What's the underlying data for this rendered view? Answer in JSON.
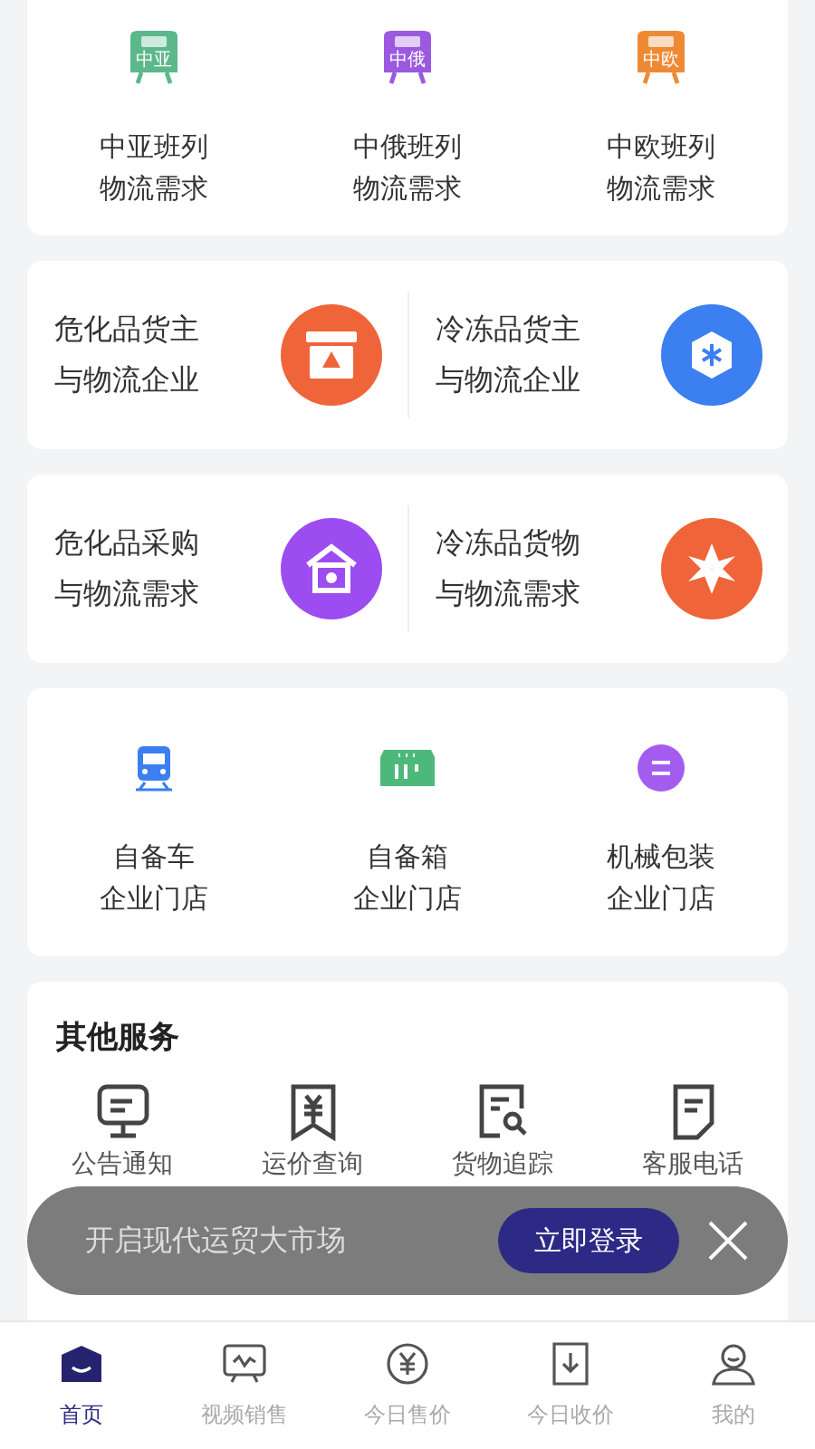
{
  "rail_routes": [
    {
      "badge": "中亚",
      "color": "#5cb88a",
      "line1": "中亚班列",
      "line2": "物流需求"
    },
    {
      "badge": "中俄",
      "color": "#9b59e0",
      "line1": "中俄班列",
      "line2": "物流需求"
    },
    {
      "badge": "中欧",
      "color": "#ef8a34",
      "line1": "中欧班列",
      "line2": "物流需求"
    }
  ],
  "feature_rows": [
    [
      {
        "line1": "危化品货主",
        "line2": "与物流企业",
        "color": "#f0643a"
      },
      {
        "line1": "冷冻品货主",
        "line2": "与物流企业",
        "color": "#3b7ff0"
      }
    ],
    [
      {
        "line1": "危化品采购",
        "line2": "与物流需求",
        "color": "#9c4cf0"
      },
      {
        "line1": "冷冻品货物",
        "line2": "与物流需求",
        "color": "#f0643a"
      }
    ]
  ],
  "stores": [
    {
      "line1": "自备车",
      "line2": "企业门店",
      "color": "#3b7ff0"
    },
    {
      "line1": "自备箱",
      "line2": "企业门店",
      "color": "#4cb87a"
    },
    {
      "line1": "机械包装",
      "line2": "企业门店",
      "color": "#a45cf0"
    }
  ],
  "other_services": {
    "title": "其他服务",
    "items": [
      {
        "label": "公告通知"
      },
      {
        "label": "运价查询"
      },
      {
        "label": "货物追踪"
      },
      {
        "label": "客服电话"
      }
    ]
  },
  "login_banner": {
    "text": "开启现代运贸大市场",
    "button": "立即登录"
  },
  "tab_bar": [
    {
      "label": "首页",
      "selected": true
    },
    {
      "label": "视频销售",
      "selected": false
    },
    {
      "label": "今日售价",
      "selected": false
    },
    {
      "label": "今日收价",
      "selected": false
    },
    {
      "label": "我的",
      "selected": false
    }
  ]
}
